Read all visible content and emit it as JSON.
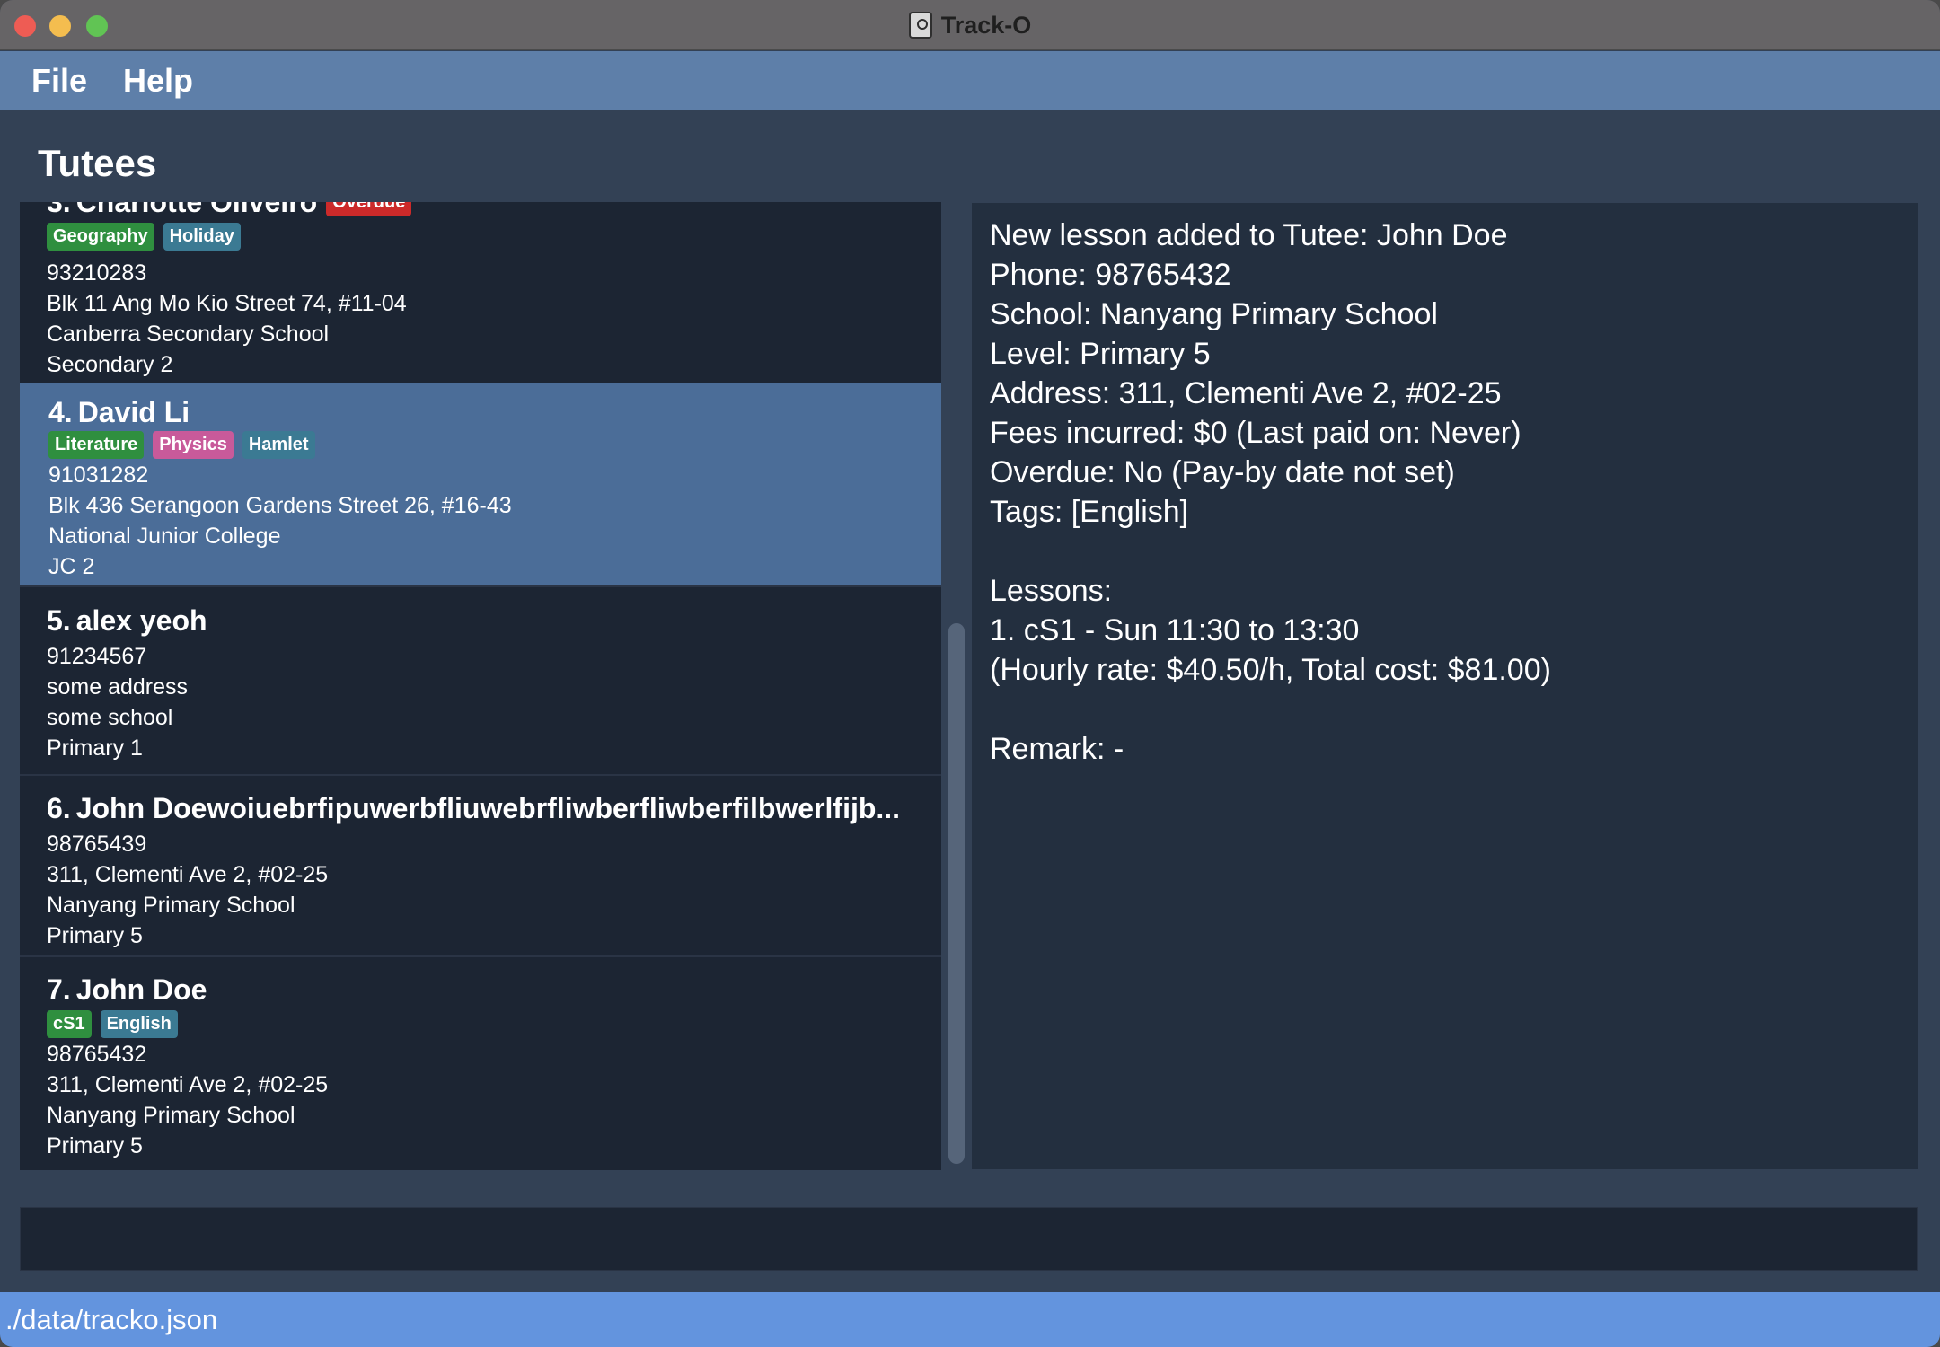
{
  "window": {
    "title": "Track-O"
  },
  "menu": {
    "file": "File",
    "help": "Help"
  },
  "list": {
    "title": "Tutees",
    "cards": [
      {
        "index": "3.",
        "name": "Charlotte Oliveiro",
        "name_tag": "Overdue",
        "tags": [
          "Geography",
          "Holiday"
        ],
        "phone": "93210283",
        "address": "Blk 11 Ang Mo Kio Street 74, #11-04",
        "school": "Canberra Secondary School",
        "level": "Secondary 2"
      },
      {
        "index": "4.",
        "name": "David Li",
        "tags": [
          "Literature",
          "Physics",
          "Hamlet"
        ],
        "phone": "91031282",
        "address": "Blk 436 Serangoon Gardens Street 26, #16-43",
        "school": "National Junior College",
        "level": "JC 2",
        "selected": true
      },
      {
        "index": "5.",
        "name": "alex yeoh",
        "tags": [],
        "phone": "91234567",
        "address": "some address",
        "school": "some school",
        "level": "Primary 1"
      },
      {
        "index": "6.",
        "name": "John Doewoiuebrfipuwerbfliuwebrfliwberfliwberfilbwerlfijb...",
        "tags": [],
        "phone": "98765439",
        "address": "311, Clementi Ave 2, #02-25",
        "school": "Nanyang Primary School",
        "level": "Primary 5"
      },
      {
        "index": "7.",
        "name": "John Doe",
        "tags": [
          "cS1",
          "English"
        ],
        "phone": "98765432",
        "address": "311, Clementi Ave 2, #02-25",
        "school": "Nanyang Primary School",
        "level": "Primary 5"
      }
    ]
  },
  "detail": {
    "lines": [
      "New lesson added to Tutee: John Doe",
      "Phone: 98765432",
      "School: Nanyang Primary School",
      "Level: Primary 5",
      "Address: 311, Clementi Ave 2, #02-25",
      "Fees incurred: $0 (Last paid on: Never)",
      "Overdue: No (Pay-by date not set)",
      "Tags: [English]",
      "",
      "Lessons:",
      "1. cS1  -  Sun 11:30 to 13:30",
      "(Hourly rate: $40.50/h, Total cost: $81.00)",
      "",
      "Remark: -"
    ]
  },
  "command": {
    "value": "",
    "placeholder": ""
  },
  "status": {
    "path": "./data/tracko.json"
  },
  "colors": {
    "menubar": "#5e7fa9",
    "selected_card": "#4b6d98",
    "tag_green": "#2f8f3f",
    "tag_teal": "#3b7a93",
    "tag_pink": "#c85a9a",
    "tag_red": "#cc2a2a",
    "statusbar": "#6394de"
  }
}
